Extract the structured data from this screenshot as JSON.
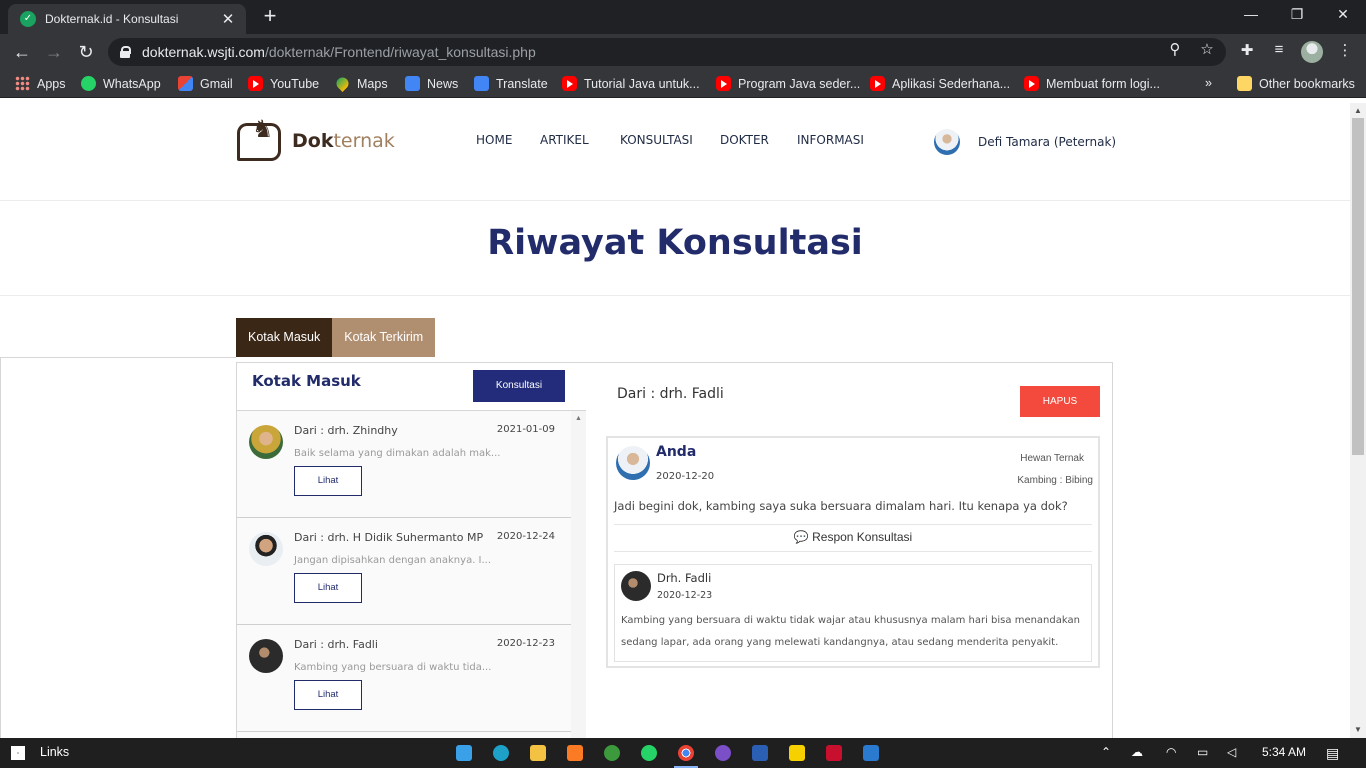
{
  "browser": {
    "tab_title": "Dokternak.id - Konsultasi",
    "url_host": "dokternak.wsjti.com",
    "url_path": "/dokternak/Frontend/riwayat_konsultasi.php",
    "bookmarks": [
      {
        "label": "Apps",
        "icon": "apps-icon"
      },
      {
        "label": "WhatsApp",
        "icon": "whatsapp-icon"
      },
      {
        "label": "Gmail",
        "icon": "gmail-icon"
      },
      {
        "label": "YouTube",
        "icon": "youtube-icon"
      },
      {
        "label": "Maps",
        "icon": "maps-icon"
      },
      {
        "label": "News",
        "icon": "news-icon"
      },
      {
        "label": "Translate",
        "icon": "translate-icon"
      },
      {
        "label": "Tutorial Java untuk...",
        "icon": "youtube-icon"
      },
      {
        "label": "Program Java seder...",
        "icon": "youtube-icon"
      },
      {
        "label": "Aplikasi Sederhana...",
        "icon": "youtube-icon"
      },
      {
        "label": "Membuat form logi...",
        "icon": "youtube-icon"
      }
    ],
    "more_bookmarks": "»",
    "other_bookmarks": "Other bookmarks"
  },
  "site": {
    "logo_text_a": "Dok",
    "logo_text_b": "ternak",
    "nav": [
      "HOME",
      "ARTIKEL",
      "KONSULTASI",
      "DOKTER",
      "INFORMASI"
    ],
    "user": "Defi Tamara (Peternak)"
  },
  "page_title": "Riwayat Konsultasi",
  "tabs": [
    "Kotak Masuk",
    "Kotak Terkirim"
  ],
  "inbox": {
    "title": "Kotak Masuk",
    "konsultasi_button": "Konsultasi",
    "items": [
      {
        "from": "Dari : drh. Zhindhy",
        "date": "2021-01-09",
        "preview": "Baik selama yang dimakan adalah mak...",
        "action": "Lihat"
      },
      {
        "from": "Dari : drh. H Didik Suhermanto MP",
        "date": "2020-12-24",
        "preview": "Jangan dipisahkan dengan anaknya. I...",
        "action": "Lihat"
      },
      {
        "from": "Dari : drh. Fadli",
        "date": "2020-12-23",
        "preview": "Kambing yang bersuara di waktu tida...",
        "action": "Lihat"
      }
    ]
  },
  "detail": {
    "from": "Dari : drh. Fadli",
    "delete_button": "HAPUS",
    "question": {
      "name": "Anda",
      "date": "2020-12-20",
      "animal_label": "Hewan Ternak",
      "animal": "Kambing : Bibing",
      "message": "Jadi begini dok, kambing saya suka bersuara dimalam hari. Itu kenapa ya dok?"
    },
    "respon_label": "Respon Konsultasi",
    "reply": {
      "name": "Drh. Fadli",
      "date": "2020-12-23",
      "text": "Kambing yang bersuara di waktu tidak wajar atau khususnya malam hari bisa menandakan sedang lapar, ada orang yang melewati kandangnya, atau sedang menderita penyakit."
    }
  },
  "taskbar": {
    "links_label": "Links",
    "time": "5:34 AM"
  }
}
